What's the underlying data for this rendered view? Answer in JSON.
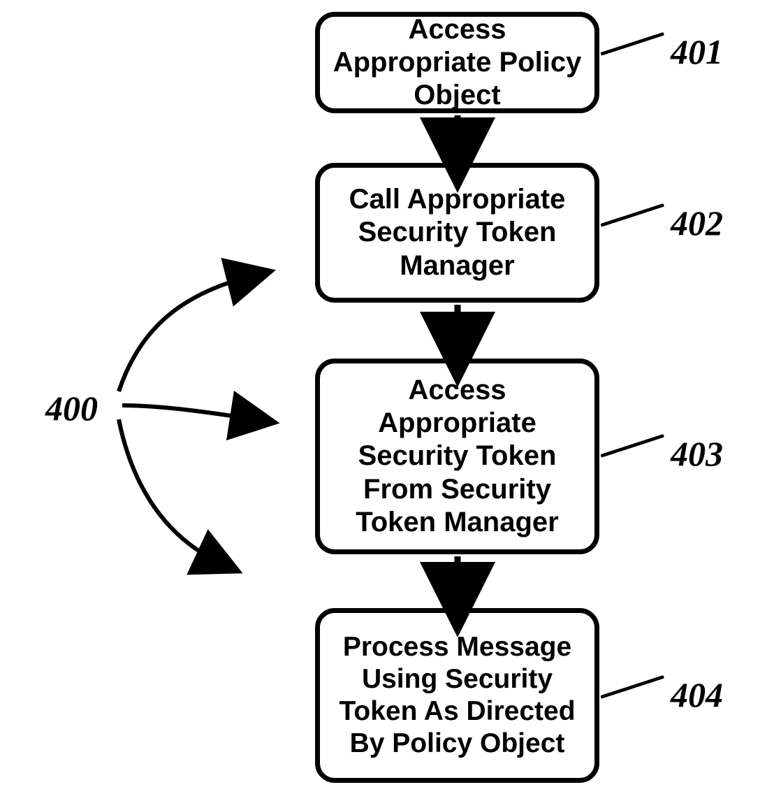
{
  "diagram": {
    "group_label": "400",
    "steps": [
      {
        "id": "401",
        "text": "Access Appropriate Policy Object"
      },
      {
        "id": "402",
        "text": "Call Appropriate Security Token Manager"
      },
      {
        "id": "403",
        "text": "Access Appropriate Security Token From Security Token Manager"
      },
      {
        "id": "404",
        "text": "Process Message Using Security Token As Directed By Policy Object"
      }
    ]
  }
}
